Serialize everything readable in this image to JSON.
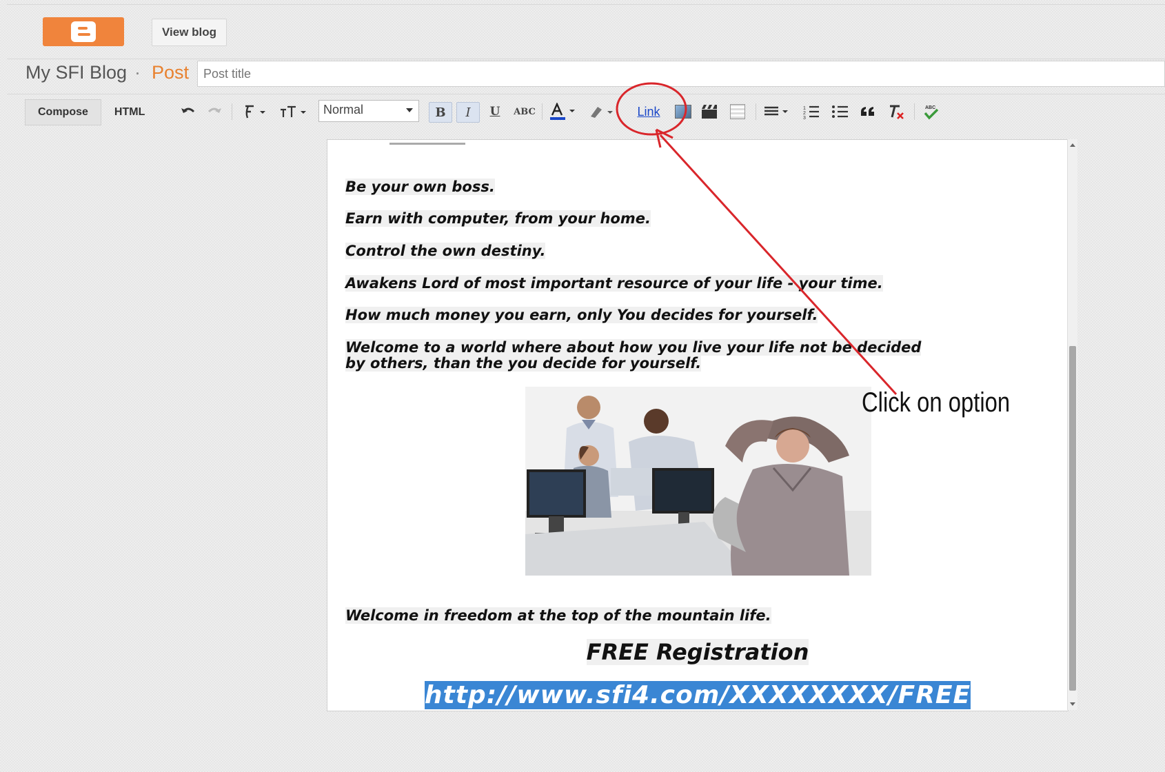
{
  "header": {
    "view_blog_label": "View blog"
  },
  "post_header": {
    "blog_name": "My SFI Blog",
    "separator": "·",
    "section": "Post",
    "title_placeholder": "Post title"
  },
  "toolbar": {
    "compose_label": "Compose",
    "html_label": "HTML",
    "font_size_value": "Normal",
    "bold_label": "B",
    "italic_label": "I",
    "underline_label": "U",
    "strike_label": "ABC",
    "link_label": "Link",
    "icons": [
      "undo-icon",
      "redo-icon",
      "font-family-icon",
      "font-size-icon",
      "bold-icon",
      "italic-icon",
      "underline-icon",
      "strikethrough-icon",
      "text-color-icon",
      "highlight-icon",
      "link-icon",
      "image-icon",
      "video-icon",
      "jump-break-icon",
      "align-icon",
      "numbered-list-icon",
      "bullet-list-icon",
      "quote-icon",
      "remove-format-icon",
      "spellcheck-icon"
    ]
  },
  "editor": {
    "lines": [
      "Be your own boss.",
      "Earn with computer, from your home.",
      "Control the own destiny.",
      "Awakens Lord of most important resource of your life - your time.",
      "How much money you earn, only You decides for yourself.",
      "Welcome to a world where about how you live your life not be decided",
      "by others, than the you decide for yourself."
    ],
    "closing_line": "Welcome in freedom at the top of the mountain life.",
    "free_registration": "FREE Registration",
    "url": "http://www.sfi4.com/XXXXXXXX/FREE"
  },
  "annotation": {
    "text": "Click on option",
    "color": "#d9262b"
  },
  "colors": {
    "brand": "#f0843c",
    "link": "#1a47c8",
    "selection": "#3a86d4"
  }
}
